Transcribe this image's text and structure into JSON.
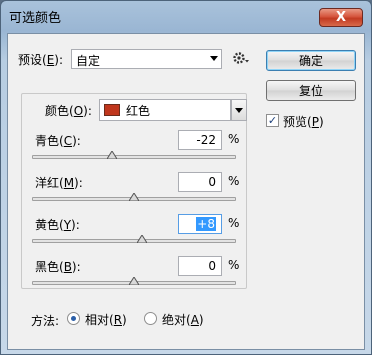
{
  "window": {
    "title": "可选颜色",
    "close_label": "X"
  },
  "preset": {
    "label": "预设(",
    "key": "E",
    "suffix": "):",
    "value": "自定"
  },
  "buttons": {
    "ok_label": "确定",
    "reset_label": "复位"
  },
  "preview": {
    "label": "预览(",
    "key": "P",
    "suffix": ")",
    "checked": true,
    "check_glyph": "✓"
  },
  "colors": {
    "label": "颜色(",
    "key": "O",
    "suffix": "):",
    "value": "红色",
    "swatch_color": "#c0361c"
  },
  "percent_sign": "%",
  "sliders": [
    {
      "label": "青色(",
      "key": "C",
      "suffix": "):",
      "value": "-22",
      "level": -22
    },
    {
      "label": "洋红(",
      "key": "M",
      "suffix": "):",
      "value": "0",
      "level": 0
    },
    {
      "label": "黄色(",
      "key": "Y",
      "suffix": "):",
      "value": "+8",
      "level": 8,
      "selected": true
    },
    {
      "label": "黑色(",
      "key": "B",
      "suffix": "):",
      "value": "0",
      "level": 0
    }
  ],
  "method": {
    "label": "方法:",
    "relative": {
      "label": "相对(",
      "key": "R",
      "suffix": ")",
      "selected": true
    },
    "absolute": {
      "label": "绝对(",
      "key": "A",
      "suffix": ")",
      "selected": false
    }
  }
}
